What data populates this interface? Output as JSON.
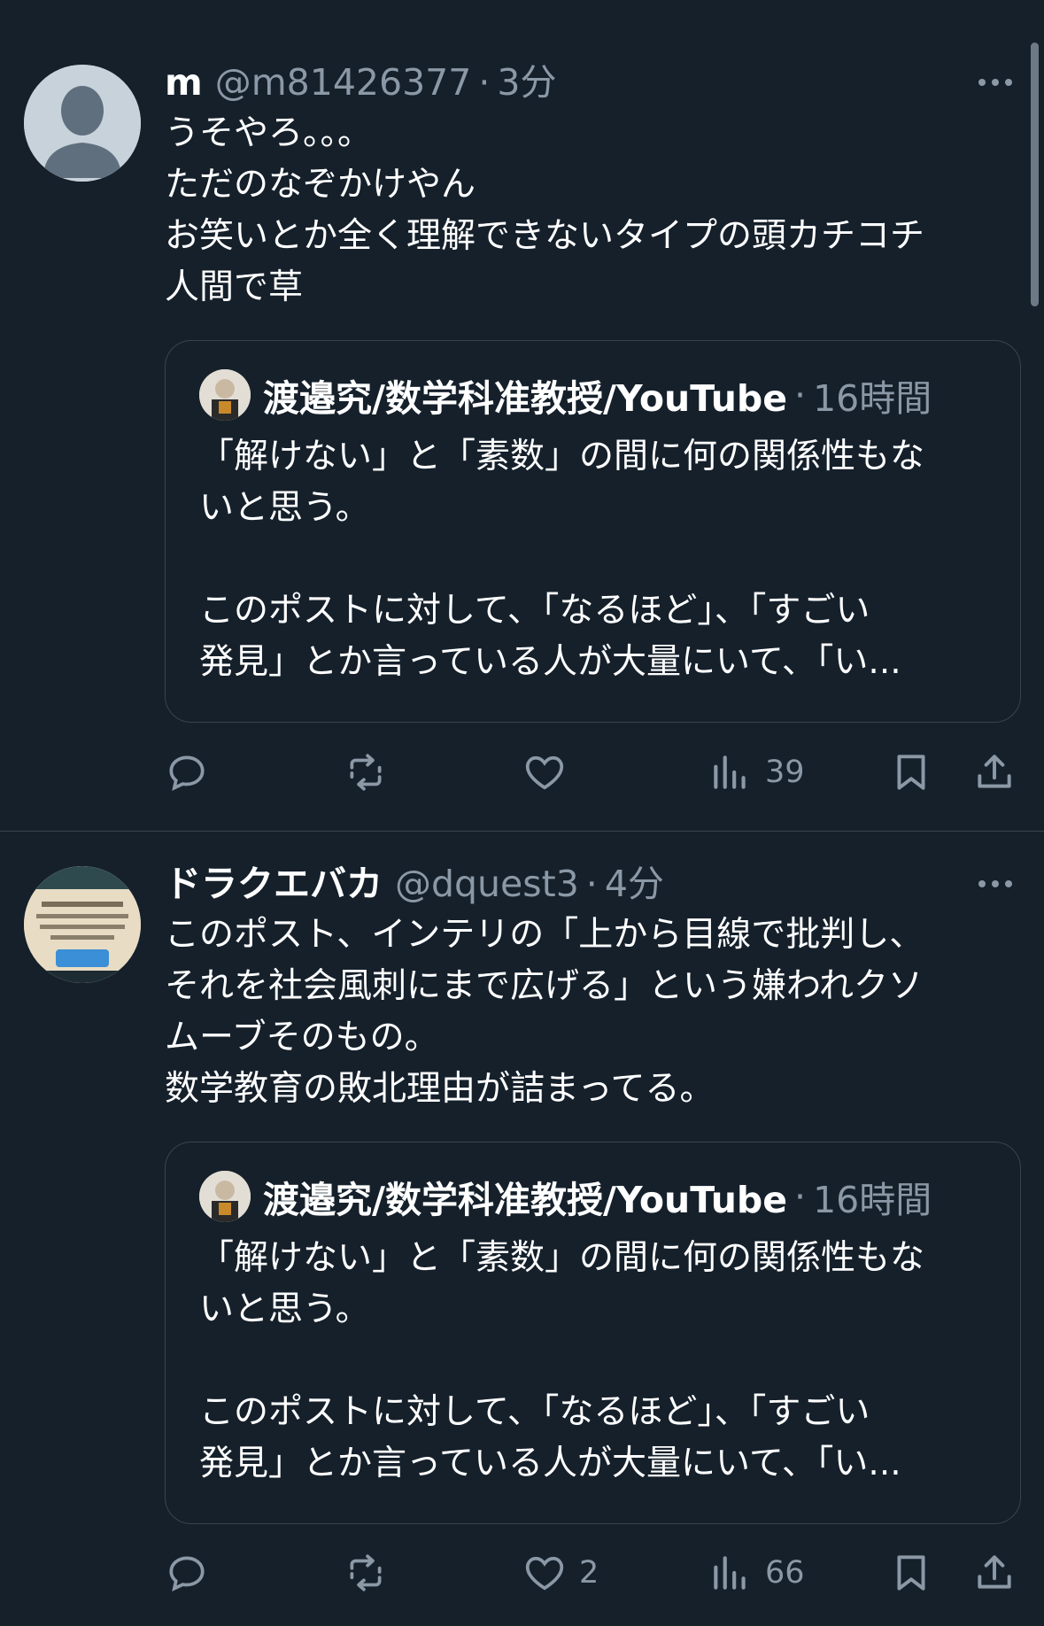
{
  "posts": [
    {
      "name": "m",
      "handle": "@m81426377",
      "sep": "·",
      "time": "3分",
      "text": "うそやろ。。。\nただのなぞかけやん\nお笑いとか全く理解できないタイプの頭カチコチ\n人間で草",
      "quote": {
        "name": "渡邉究/数学科准教授/YouTube",
        "sep": "·",
        "time": "16時間",
        "text": "「解けない」と「素数」の間に何の関係性もな\nいと思う。\n\nこのポストに対して、「なるほど」、「すごい\n発見」とか言っている人が大量にいて、「い..."
      },
      "actions": {
        "replies": "",
        "reposts": "",
        "likes": "",
        "views": "39"
      }
    },
    {
      "name": "ドラクエバカ",
      "handle": "@dquest3",
      "sep": "·",
      "time": "4分",
      "text": "このポスト、インテリの「上から目線で批判し、\nそれを社会風刺にまで広げる」という嫌われクソ\nムーブそのもの。\n数学教育の敗北理由が詰まってる。",
      "quote": {
        "name": "渡邉究/数学科准教授/YouTube",
        "sep": "·",
        "time": "16時間",
        "text": "「解けない」と「素数」の間に何の関係性もな\nいと思う。\n\nこのポストに対して、「なるほど」、「すごい\n発見」とか言っている人が大量にいて、「い..."
      },
      "actions": {
        "replies": "",
        "reposts": "",
        "likes": "2",
        "views": "66"
      }
    }
  ],
  "icons": {
    "avatar": "default-avatar-icon",
    "reply": "reply-icon",
    "repost": "repost-icon",
    "like": "heart-icon",
    "views": "views-icon",
    "bookmark": "bookmark-icon",
    "share": "share-icon",
    "more": "more-icon"
  },
  "colors": {
    "background": "#15202b",
    "secondary_text": "#8b98a5",
    "border": "#38444d"
  }
}
